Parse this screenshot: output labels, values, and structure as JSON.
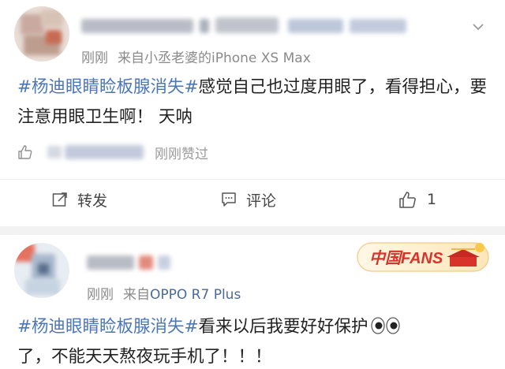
{
  "post1": {
    "meta_time": "刚刚",
    "meta_via": "来自小丞老婆的",
    "meta_device": "iPhone XS Max",
    "hashtag": "#杨迪眼睛睑板腺消失#",
    "body": "感觉自己也过度用眼了，看得担心，要注意用眼卫生啊！  天呐",
    "liked_text": "刚刚赞过",
    "repost_label": "转发",
    "comment_label": "评论",
    "like_count": "1"
  },
  "post2": {
    "meta_time": "刚刚",
    "meta_via": "来自",
    "meta_device": "OPPO R7 Plus",
    "hashtag": "#杨迪眼睛睑板腺消失#",
    "body_line1": "看来以后我要好好保护",
    "body_line2": "了，不能天天熬夜玩手机了！！！",
    "badge_text": "中国FANS"
  },
  "colors": {
    "hashtag": "#4b76ba",
    "meta": "#8a8a8a",
    "background": "#f2f2f2"
  },
  "icons": [
    "chevron-down-icon",
    "thumb-up-icon",
    "share-icon",
    "comment-icon",
    "eyes-emoji-icon",
    "china-fans-badge-icon"
  ]
}
